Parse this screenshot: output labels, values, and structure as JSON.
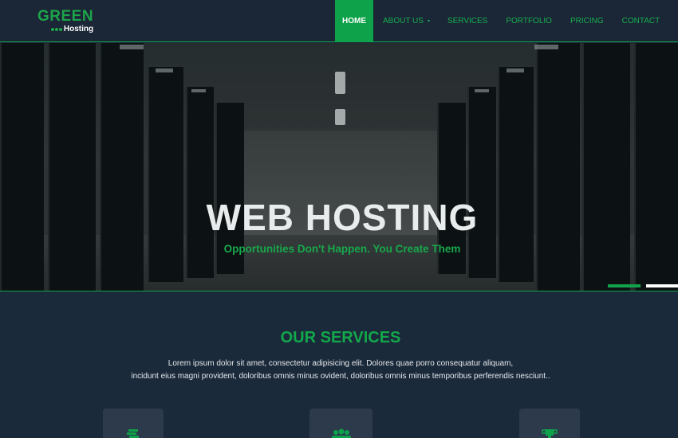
{
  "brand": {
    "name_top": "GREEN",
    "name_bottom": "Hosting",
    "accent": "#0ea24a"
  },
  "nav": {
    "home": "HOME",
    "about": "ABOUT US",
    "services": "SERVICES",
    "portfolio": "PORTFOLIO",
    "pricing": "PRICING",
    "contact": "CONTACT",
    "active": "HOME"
  },
  "hero": {
    "title": "WEB HOSTING",
    "subtitle": "Opportunities Don't Happen. You Create Them",
    "slides": 2,
    "active_slide": 1
  },
  "services": {
    "title": "OUR SERVICES",
    "desc_line1": "Lorem ipsum dolor sit amet, consectetur adipisicing elit. Dolores quae porro consequatur aliquam,",
    "desc_line2": "incidunt eius magni provident, doloribus omnis minus ovident, doloribus omnis minus temporibus perferendis nesciunt..",
    "cards": [
      {
        "icon": "document-stack-icon"
      },
      {
        "icon": "users-group-icon"
      },
      {
        "icon": "trophy-icon"
      }
    ]
  }
}
